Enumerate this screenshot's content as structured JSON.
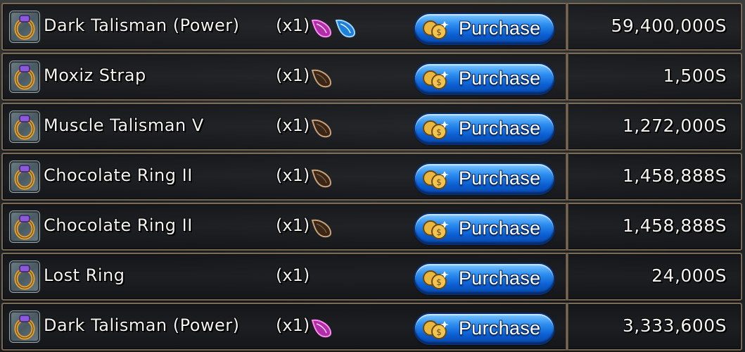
{
  "shop": {
    "purchase_label": "Purchase",
    "items": [
      {
        "name": "Dark Talisman (Power)",
        "quantity": "(x1)",
        "gems": [
          "pink-gem-icon",
          "blue-gem-icon"
        ],
        "price": "59,400,000S"
      },
      {
        "name": "Moxiz Strap",
        "quantity": "(x1)",
        "gems": [
          "brown-gem-icon"
        ],
        "price": "1,500S"
      },
      {
        "name": "Muscle Talisman V",
        "quantity": "(x1)",
        "gems": [
          "brown-gem-icon"
        ],
        "price": "1,272,000S"
      },
      {
        "name": "Chocolate Ring II",
        "quantity": "(x1)",
        "gems": [
          "brown-gem-icon"
        ],
        "price": "1,458,888S"
      },
      {
        "name": "Chocolate Ring II",
        "quantity": "(x1)",
        "gems": [
          "brown-gem-icon"
        ],
        "price": "1,458,888S"
      },
      {
        "name": "Lost Ring",
        "quantity": "(x1)",
        "gems": [],
        "price": "24,000S"
      },
      {
        "name": "Dark Talisman (Power)",
        "quantity": "(x1)",
        "gems": [
          "pink-gem-icon"
        ],
        "price": "3,333,600S"
      }
    ]
  },
  "colors": {
    "button_blue": "#0b5fd3",
    "row_border": "#7a6a55",
    "gem_pink": "#c23fb0",
    "gem_blue": "#3aa0f0",
    "gem_brown": "#6b4a2a"
  }
}
